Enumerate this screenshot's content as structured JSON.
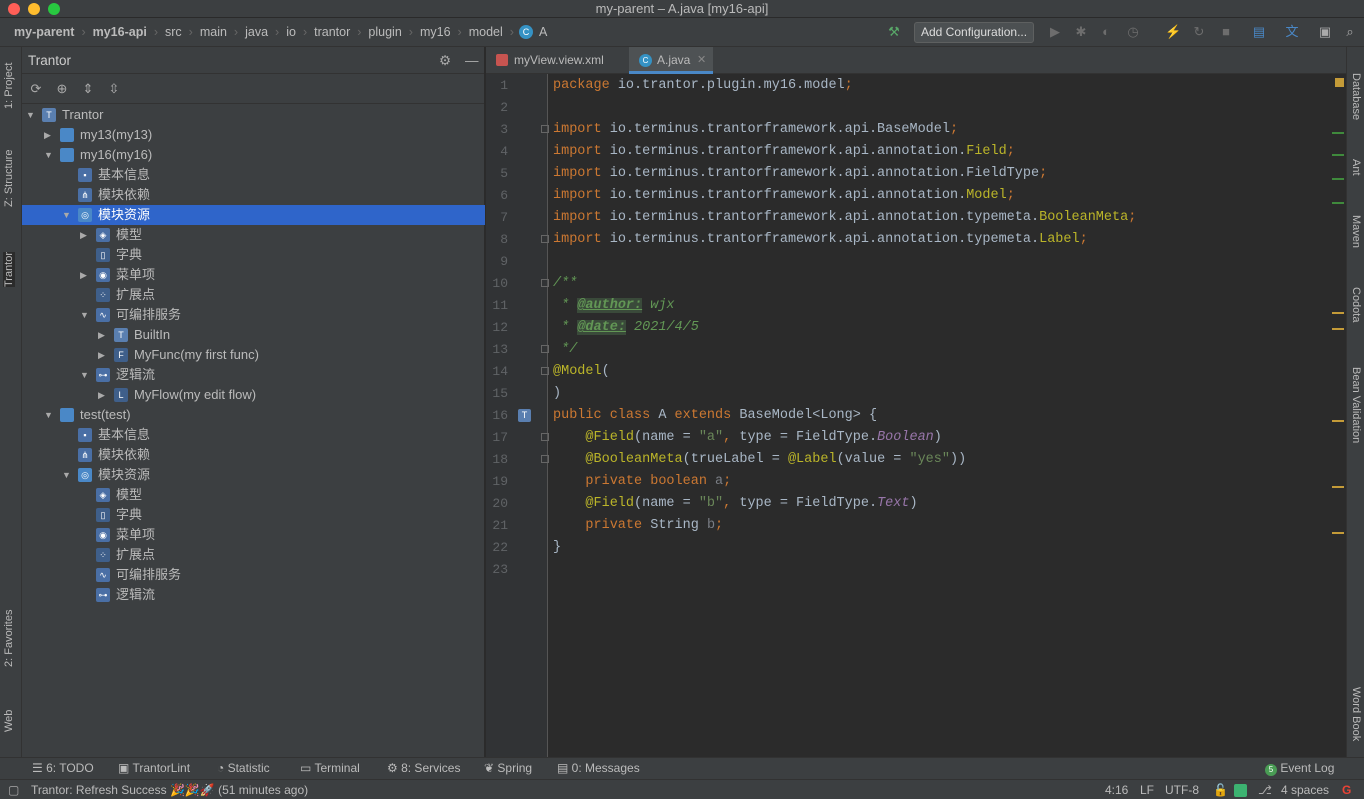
{
  "window": {
    "title": "my-parent – A.java [my16-api]"
  },
  "breadcrumbs": [
    "my-parent",
    "my16-api",
    "src",
    "main",
    "java",
    "io",
    "trantor",
    "plugin",
    "my16",
    "model",
    "A"
  ],
  "toolbar": {
    "add_config": "Add Configuration..."
  },
  "left_stripe": {
    "project": "1: Project",
    "structure": "Z: Structure",
    "trantor": "Trantor",
    "favorites": "2: Favorites",
    "web": "Web"
  },
  "right_stripe": {
    "database": "Database",
    "ant": "Ant",
    "maven": "Maven",
    "codota": "Codota",
    "bean": "Bean Validation",
    "wordbook": "Word Book"
  },
  "panel": {
    "title": "Trantor"
  },
  "tree": [
    {
      "label": "Trantor",
      "depth": 0,
      "arrow": "down",
      "icon": "T"
    },
    {
      "label": "my13(my13)",
      "depth": 1,
      "arrow": "right",
      "icon": "folder"
    },
    {
      "label": "my16(my16)",
      "depth": 1,
      "arrow": "down",
      "icon": "folder"
    },
    {
      "label": "基本信息",
      "depth": 2,
      "arrow": "",
      "icon": "info"
    },
    {
      "label": "模块依赖",
      "depth": 2,
      "arrow": "",
      "icon": "dep"
    },
    {
      "label": "模块资源",
      "depth": 2,
      "arrow": "down",
      "icon": "globe",
      "selected": true
    },
    {
      "label": "模型",
      "depth": 3,
      "arrow": "right",
      "icon": "model"
    },
    {
      "label": "字典",
      "depth": 3,
      "arrow": "",
      "icon": "dict"
    },
    {
      "label": "菜单项",
      "depth": 3,
      "arrow": "right",
      "icon": "menu"
    },
    {
      "label": "扩展点",
      "depth": 3,
      "arrow": "",
      "icon": "ext"
    },
    {
      "label": "可编排服务",
      "depth": 3,
      "arrow": "down",
      "icon": "svc"
    },
    {
      "label": "BuiltIn",
      "depth": 4,
      "arrow": "right",
      "icon": "T"
    },
    {
      "label": "MyFunc(my first func)",
      "depth": 4,
      "arrow": "right",
      "icon": "fn"
    },
    {
      "label": "逻辑流",
      "depth": 3,
      "arrow": "down",
      "icon": "flow"
    },
    {
      "label": "MyFlow(my edit flow)",
      "depth": 4,
      "arrow": "right",
      "icon": "ln"
    },
    {
      "label": "test(test)",
      "depth": 1,
      "arrow": "down",
      "icon": "folder"
    },
    {
      "label": "基本信息",
      "depth": 2,
      "arrow": "",
      "icon": "info"
    },
    {
      "label": "模块依赖",
      "depth": 2,
      "arrow": "",
      "icon": "dep"
    },
    {
      "label": "模块资源",
      "depth": 2,
      "arrow": "down",
      "icon": "globe"
    },
    {
      "label": "模型",
      "depth": 3,
      "arrow": "",
      "icon": "model"
    },
    {
      "label": "字典",
      "depth": 3,
      "arrow": "",
      "icon": "dict"
    },
    {
      "label": "菜单项",
      "depth": 3,
      "arrow": "",
      "icon": "menu"
    },
    {
      "label": "扩展点",
      "depth": 3,
      "arrow": "",
      "icon": "ext"
    },
    {
      "label": "可编排服务",
      "depth": 3,
      "arrow": "",
      "icon": "svc"
    },
    {
      "label": "逻辑流",
      "depth": 3,
      "arrow": "",
      "icon": "flow"
    }
  ],
  "tabs": [
    {
      "label": "myView.view.xml",
      "active": false
    },
    {
      "label": "A.java",
      "active": true
    }
  ],
  "code_lines": [
    [
      [
        "k",
        "package "
      ],
      [
        "",
        "io.trantor.plugin.my16.model"
      ],
      [
        "k",
        ";"
      ]
    ],
    [],
    [
      [
        "k",
        "import "
      ],
      [
        "",
        "io.terminus.trantorframework.api.BaseModel"
      ],
      [
        "k",
        ";"
      ]
    ],
    [
      [
        "k",
        "import "
      ],
      [
        "",
        "io.terminus.trantorframework.api.annotation."
      ],
      [
        "a",
        "Field"
      ],
      [
        "k",
        ";"
      ]
    ],
    [
      [
        "k",
        "import "
      ],
      [
        "",
        "io.terminus.trantorframework.api.annotation.FieldType"
      ],
      [
        "k",
        ";"
      ]
    ],
    [
      [
        "k",
        "import "
      ],
      [
        "",
        "io.terminus.trantorframework.api.annotation."
      ],
      [
        "a",
        "Model"
      ],
      [
        "k",
        ";"
      ]
    ],
    [
      [
        "k",
        "import "
      ],
      [
        "",
        "io.terminus.trantorframework.api.annotation.typemeta."
      ],
      [
        "a",
        "BooleanMeta"
      ],
      [
        "k",
        ";"
      ]
    ],
    [
      [
        "k",
        "import "
      ],
      [
        "",
        "io.terminus.trantorframework.api.annotation.typemeta."
      ],
      [
        "a",
        "Label"
      ],
      [
        "k",
        ";"
      ]
    ],
    [],
    [
      [
        "c",
        "/**"
      ]
    ],
    [
      [
        "c",
        " * "
      ],
      [
        "t",
        "@author:"
      ],
      [
        "c",
        " wjx"
      ]
    ],
    [
      [
        "c",
        " * "
      ],
      [
        "t",
        "@date:"
      ],
      [
        "c",
        " 2021/4/5"
      ]
    ],
    [
      [
        "c",
        " */"
      ]
    ],
    [
      [
        "a",
        "@Model"
      ],
      [
        "",
        "("
      ]
    ],
    [
      [
        "",
        ")"
      ]
    ],
    [
      [
        "k",
        "public class "
      ],
      [
        "",
        "A "
      ],
      [
        "k",
        "extends "
      ],
      [
        "",
        "BaseModel<Long> {"
      ]
    ],
    [
      [
        "",
        "    "
      ],
      [
        "a",
        "@Field"
      ],
      [
        "",
        "(name = "
      ],
      [
        "s",
        "\"a\""
      ],
      [
        "k",
        ", "
      ],
      [
        "",
        "type = FieldType."
      ],
      [
        "p",
        "Boolean"
      ],
      [
        "",
        ")"
      ]
    ],
    [
      [
        "",
        "    "
      ],
      [
        "a",
        "@BooleanMeta"
      ],
      [
        "",
        "(trueLabel = "
      ],
      [
        "a",
        "@Label"
      ],
      [
        "",
        "(value = "
      ],
      [
        "s",
        "\"yes\""
      ],
      [
        "",
        "))"
      ]
    ],
    [
      [
        "",
        "    "
      ],
      [
        "k",
        "private boolean "
      ],
      [
        "g",
        "a"
      ],
      [
        "k",
        ";"
      ]
    ],
    [
      [
        "",
        "    "
      ],
      [
        "a",
        "@Field"
      ],
      [
        "",
        "(name = "
      ],
      [
        "s",
        "\"b\""
      ],
      [
        "k",
        ", "
      ],
      [
        "",
        "type = FieldType."
      ],
      [
        "p",
        "Text"
      ],
      [
        "",
        ")"
      ]
    ],
    [
      [
        "",
        "    "
      ],
      [
        "k",
        "private "
      ],
      [
        "",
        "String "
      ],
      [
        "g",
        "b"
      ],
      [
        "k",
        ";"
      ]
    ],
    [
      [
        "",
        "}"
      ]
    ],
    []
  ],
  "bottom_tools": {
    "todo": "6: TODO",
    "lint": "TrantorLint",
    "statistic": "Statistic",
    "terminal": "Terminal",
    "services": "8: Services",
    "spring": "Spring",
    "messages": "0: Messages",
    "eventlog": "Event Log",
    "eventlog_count": "5"
  },
  "status": {
    "message": "Trantor: Refresh Success 🎉🎉🚀 (51 minutes ago)",
    "position": "4:16",
    "line_sep": "LF",
    "encoding": "UTF-8",
    "indent": "4 spaces"
  },
  "colors": {
    "selection": "#2f65ca",
    "keyword": "#cc7832",
    "annotation": "#bbb529",
    "string": "#6a8759",
    "doc": "#629755"
  }
}
